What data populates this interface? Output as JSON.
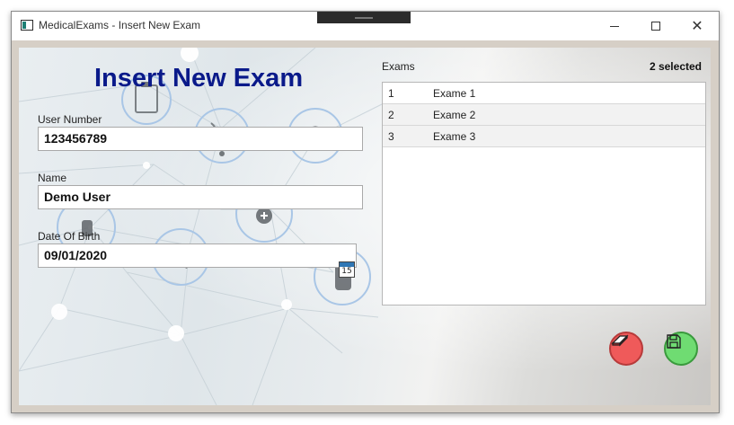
{
  "window": {
    "title": "MedicalExams - Insert New Exam",
    "close_glyph": "✕"
  },
  "form": {
    "heading": "Insert New Exam",
    "user_number_label": "User Number",
    "user_number_value": "123456789",
    "name_label": "Name",
    "name_value": "Demo User",
    "dob_label": "Date Of Birth",
    "dob_value": "09/01/2020",
    "calendar_day": "15"
  },
  "exams": {
    "label": "Exams",
    "selected_count": "2 selected",
    "rows": [
      {
        "num": "1",
        "name": "Exame 1",
        "selected": false
      },
      {
        "num": "2",
        "name": "Exame 2",
        "selected": true
      },
      {
        "num": "3",
        "name": "Exame 3",
        "selected": true
      }
    ]
  },
  "buttons": {
    "clear_icon": "eraser-icon",
    "save_icon": "floppy-disk-icon"
  },
  "colors": {
    "heading": "#0a1a8a",
    "clear_button": "#ef5a5a",
    "save_button": "#6fdc72",
    "client_border": "#d6cfc6"
  }
}
